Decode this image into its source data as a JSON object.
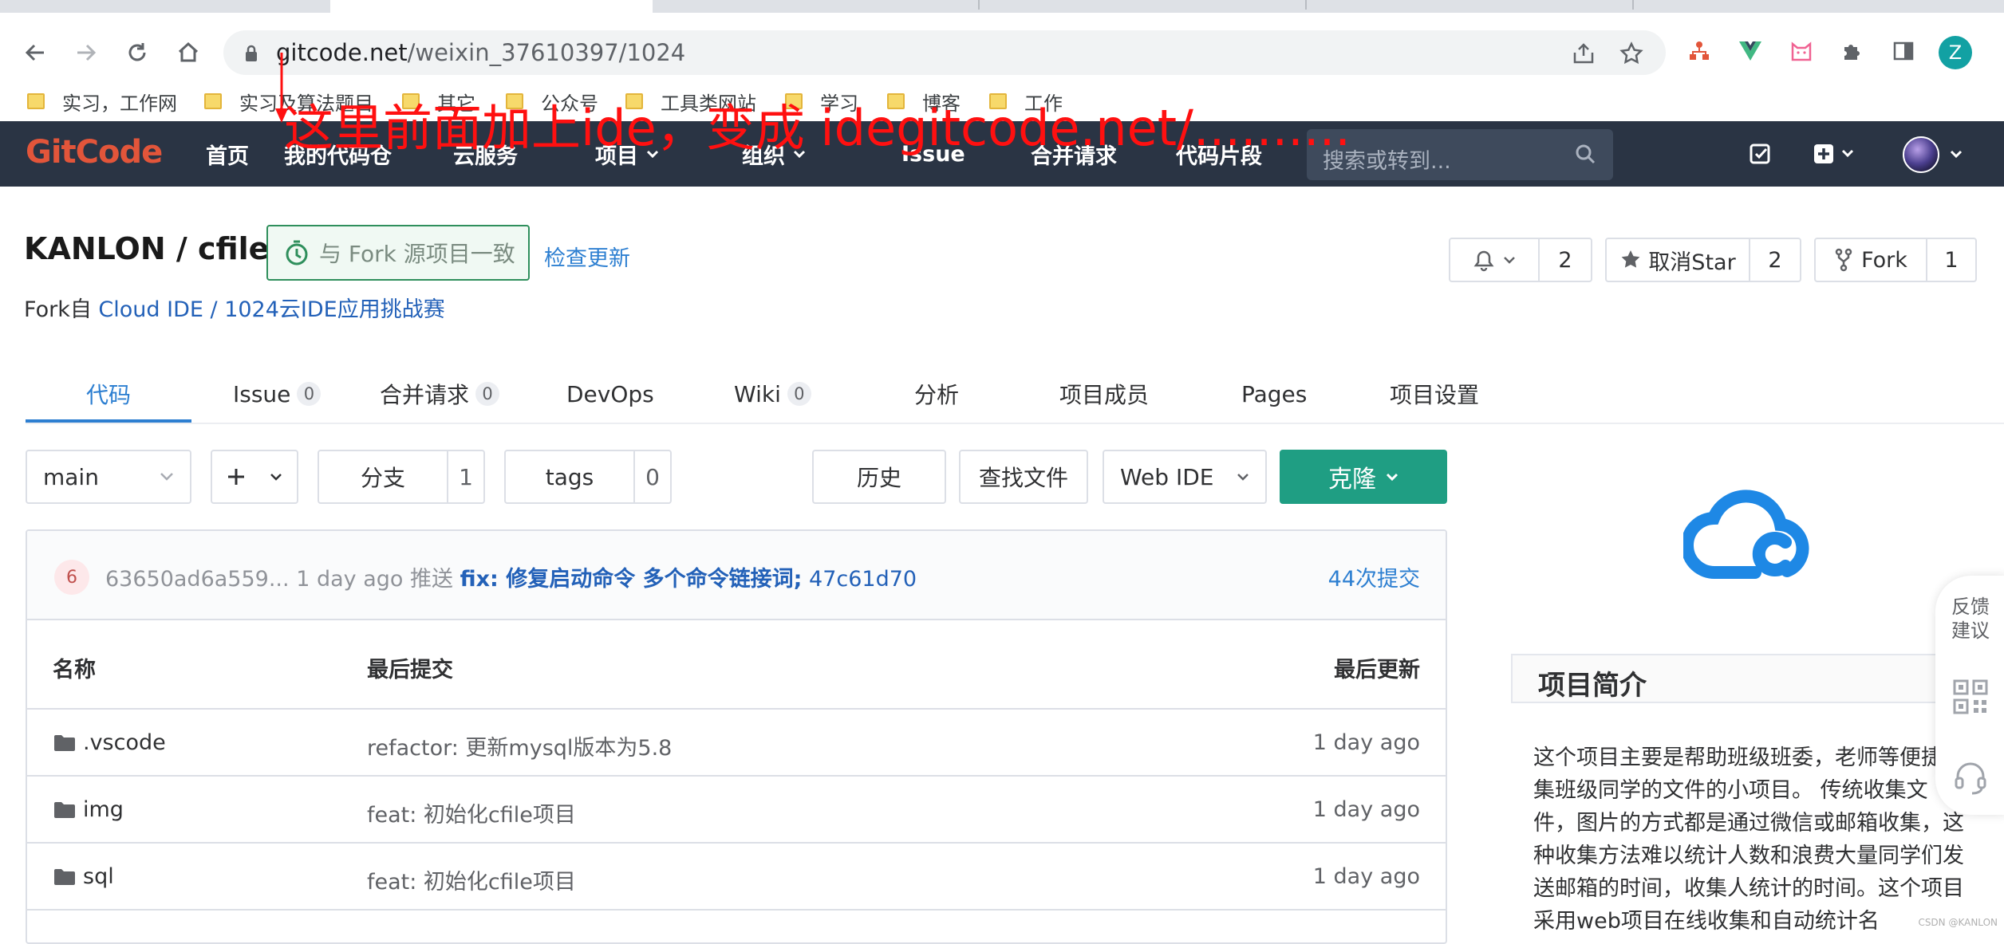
{
  "browser": {
    "url_host": "gitcode.net",
    "url_path": "/weixin_37610397/1024",
    "profile_initial": "Z",
    "bookmarks": [
      "实习，工作网",
      "实习及算法题目",
      "其它",
      "公众号",
      "工具类网站",
      "学习",
      "博客",
      "工作"
    ]
  },
  "site": {
    "logo": "GitCode",
    "nav": [
      "首页",
      "我的代码仓",
      "云服务",
      "项目",
      "组织",
      "Issue",
      "合并请求",
      "代码片段"
    ],
    "search_placeholder": "搜索或转到..."
  },
  "annotation": "这里前面加上ide，变成 idegitcode.net/..........",
  "project": {
    "owner": "KANLON",
    "name": "cfile",
    "title": "KANLON / cfile",
    "fork_badge": "与 Fork 源项目一致",
    "check_update": "检查更新",
    "fork_from_prefix": "Fork自",
    "fork_from_link": "Cloud IDE / 1024云IDE应用挑战赛",
    "watch_count": "2",
    "star_label": "取消Star",
    "star_count": "2",
    "fork_label": "Fork",
    "fork_count": "1"
  },
  "tabs": [
    {
      "label": "代码",
      "count": null
    },
    {
      "label": "Issue",
      "count": "0"
    },
    {
      "label": "合并请求",
      "count": "0"
    },
    {
      "label": "DevOps",
      "count": null
    },
    {
      "label": "Wiki",
      "count": "0"
    },
    {
      "label": "分析",
      "count": null
    },
    {
      "label": "项目成员",
      "count": null
    },
    {
      "label": "Pages",
      "count": null
    },
    {
      "label": "项目设置",
      "count": null
    }
  ],
  "repo_toolbar": {
    "branch": "main",
    "plus": "+",
    "branches_label": "分支",
    "branches_count": "1",
    "tags_label": "tags",
    "tags_count": "0",
    "history": "历史",
    "find_file": "查找文件",
    "web_ide": "Web IDE",
    "clone": "克隆"
  },
  "last_commit": {
    "avatar": "6",
    "hash": "63650ad6a559...",
    "time": "1 day ago",
    "action": "推送",
    "message": "fix: 修复启动命令 多个命令链接词;",
    "short_sha": "47c61d70",
    "commit_count": "44次提交"
  },
  "table": {
    "headers": [
      "名称",
      "最后提交",
      "最后更新"
    ],
    "rows": [
      {
        "name": ".vscode",
        "commit": "refactor: 更新mysql版本为5.8",
        "updated": "1 day ago"
      },
      {
        "name": "img",
        "commit": "feat: 初始化cfile项目",
        "updated": "1 day ago"
      },
      {
        "name": "sql",
        "commit": "feat: 初始化cfile项目",
        "updated": "1 day ago"
      }
    ]
  },
  "sidebar": {
    "intro_title": "项目简介",
    "intro_text": "这个项目主要是帮助班级班委，老师等便捷收集班级同学的文件的小项目。 传统收集文件，图片的方式都是通过微信或邮箱收集，这种收集方法难以统计人数和浪费大量同学们发送邮箱的时间，收集人统计的时间。这个项目采用web项目在线收集和自动统计名",
    "feedback": "反馈建议"
  },
  "watermark": "CSDN @KANLON",
  "colors": {
    "header_bg": "#2a3444",
    "accent": "#2d7fd1",
    "clone_green": "#1f9e83",
    "annotation_red": "#ff1010",
    "logo_red": "#e2553a"
  }
}
